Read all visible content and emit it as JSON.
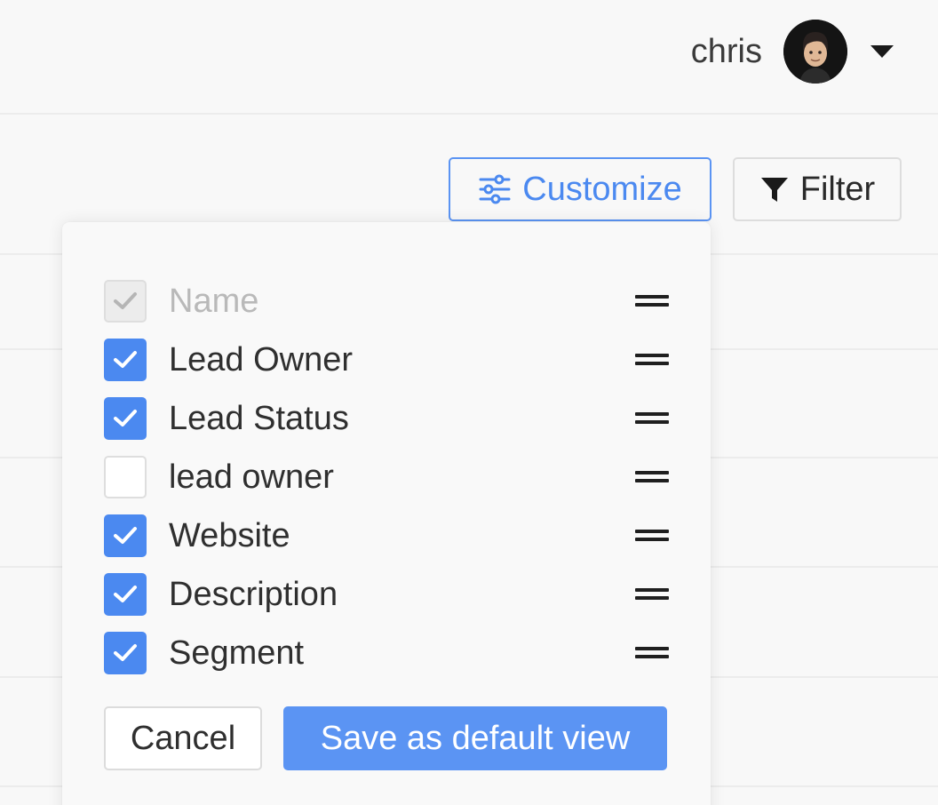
{
  "header": {
    "user_name": "chris",
    "avatar_icon": "user-avatar",
    "menu_icon": "caret-down-icon"
  },
  "toolbar": {
    "customize_label": "Customize",
    "customize_icon": "sliders-icon",
    "filter_label": "Filter",
    "filter_icon": "funnel-icon",
    "accent_color": "#4b89f0"
  },
  "customize_panel": {
    "fields": [
      {
        "label": "Name",
        "checked": true,
        "disabled": true
      },
      {
        "label": "Lead Owner",
        "checked": true,
        "disabled": false
      },
      {
        "label": "Lead Status",
        "checked": true,
        "disabled": false
      },
      {
        "label": "lead owner",
        "checked": false,
        "disabled": false
      },
      {
        "label": "Website",
        "checked": true,
        "disabled": false
      },
      {
        "label": "Description",
        "checked": true,
        "disabled": false
      },
      {
        "label": "Segment",
        "checked": true,
        "disabled": false
      }
    ],
    "cancel_label": "Cancel",
    "save_label": "Save as default view"
  }
}
